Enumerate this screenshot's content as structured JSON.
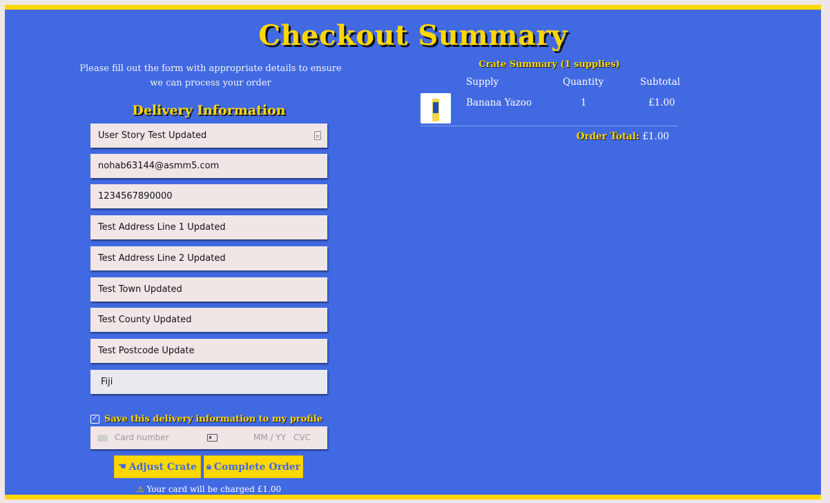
{
  "page": {
    "title": "Checkout Summary",
    "intro": "Please fill out the form with appropriate details to ensure we can process your order"
  },
  "delivery": {
    "heading": "Delivery Information",
    "fields": {
      "full_name": "User Story Test Updated",
      "email": "nohab63144@asmm5.com",
      "phone": "1234567890000",
      "address1": "Test Address Line 1 Updated",
      "address2": "Test Address Line 2 Updated",
      "town": "Test Town Updated",
      "county": "Test County Updated",
      "postcode": "Test Postcode Update",
      "country": "Fiji"
    },
    "save_info_label": "Save this delivery information to my profile",
    "save_info_checked": true
  },
  "card": {
    "number_placeholder": "Card number",
    "expiry_placeholder": "MM / YY",
    "cvc_placeholder": "CVC"
  },
  "actions": {
    "adjust_label": "Adjust Crate",
    "complete_label": "Complete Order",
    "charge_note": "Your card will be charged £1.00"
  },
  "crate": {
    "heading": "Crate Summary (1 supplies)",
    "columns": [
      "Supply",
      "Quantity",
      "Subtotal"
    ],
    "items": [
      {
        "name": "Banana Yazoo",
        "quantity": "1",
        "subtotal": "£1.00",
        "image_icon": "yazoo-bottle-image"
      }
    ],
    "total_label": "Order Total:",
    "total_value": "£1.00"
  },
  "colors": {
    "background": "#4169e1",
    "accent": "#ffd700",
    "field": "#f0e6e6",
    "page": "#efe7e7"
  }
}
